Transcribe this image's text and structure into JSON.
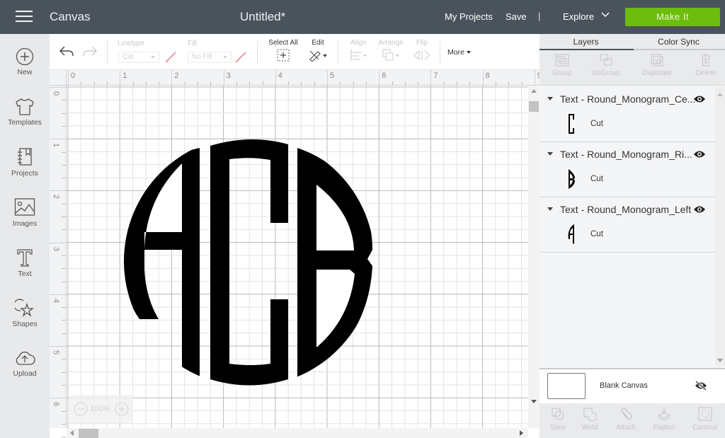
{
  "header": {
    "app_name": "Canvas",
    "doc_title": "Untitled*",
    "my_projects": "My Projects",
    "save": "Save",
    "separator": "|",
    "explore": "Explore",
    "make_it": "Make It",
    "make_it_color": "#6cbd0e",
    "bg_color": "#4a535c"
  },
  "sidebar": {
    "items": [
      {
        "label": "New",
        "icon": "plus-circle-icon"
      },
      {
        "label": "Templates",
        "icon": "tshirt-icon"
      },
      {
        "label": "Projects",
        "icon": "notebook-icon"
      },
      {
        "label": "Images",
        "icon": "image-icon"
      },
      {
        "label": "Text",
        "icon": "text-t-icon"
      },
      {
        "label": "Shapes",
        "icon": "shapes-icon"
      },
      {
        "label": "Upload",
        "icon": "cloud-upload-icon"
      }
    ]
  },
  "toolbar": {
    "undo": "undo",
    "redo": "redo",
    "linetype_label": "Linetype",
    "linetype_value": "Cut",
    "fill_label": "Fill",
    "fill_value": "No Fill",
    "select_all": "Select All",
    "edit": "Edit",
    "align": "Align",
    "arrange": "Arrange",
    "flip": "Flip",
    "more": "More"
  },
  "rulers": {
    "horizontal": [
      "0",
      "1",
      "2",
      "3",
      "4",
      "5",
      "6",
      "7",
      "8",
      "9"
    ],
    "vertical": [
      "0",
      "1",
      "2",
      "3",
      "4",
      "5",
      "6"
    ]
  },
  "canvas": {
    "monogram_letters": "ACB",
    "zoom_level": "100%"
  },
  "panel": {
    "tabs": [
      {
        "label": "Layers",
        "active": true
      },
      {
        "label": "Color Sync",
        "active": false
      }
    ],
    "actions": [
      "Group",
      "UnGroup",
      "Duplicate",
      "Delete"
    ],
    "layers": [
      {
        "name": "Text - Round_Monogram_Ce...",
        "operation": "Cut",
        "glyph": "C"
      },
      {
        "name": "Text - Round_Monogram_Ri...",
        "operation": "Cut",
        "glyph": "B"
      },
      {
        "name": "Text - Round_Monogram_Left",
        "operation": "Cut",
        "glyph": "A"
      }
    ],
    "blank_canvas": "Blank Canvas",
    "bottom_actions": [
      "Slice",
      "Weld",
      "Attach",
      "Flatten",
      "Contour"
    ]
  }
}
